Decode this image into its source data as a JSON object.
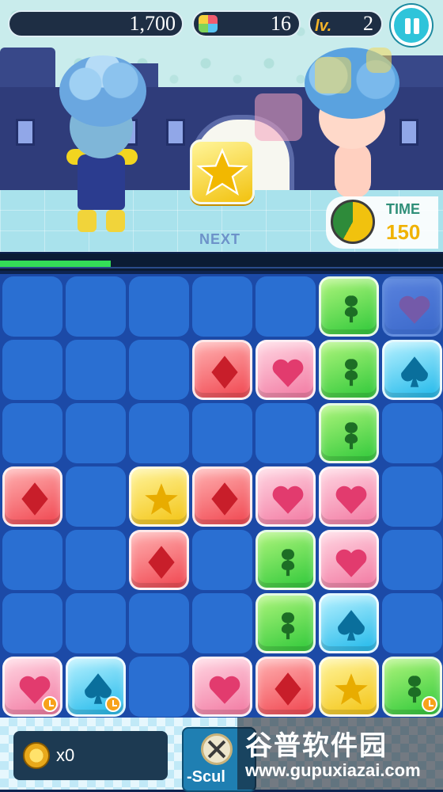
{
  "hud": {
    "score": "1,700",
    "piece_count": "16",
    "level_label": "lv.",
    "level": "2"
  },
  "next": {
    "label": "NEXT",
    "shape": "star"
  },
  "timer": {
    "label": "TIME",
    "value": "150",
    "remaining_fraction": 0.58
  },
  "progress": {
    "fraction": 0.25
  },
  "board": {
    "rows": 7,
    "cols": 7,
    "cells": [
      [
        "",
        "",
        "",
        "",
        "",
        "club",
        "ghost-heart"
      ],
      [
        "",
        "",
        "",
        "diamond",
        "heart",
        "club",
        "spade"
      ],
      [
        "",
        "",
        "",
        "",
        "",
        "club",
        ""
      ],
      [
        "diamond",
        "",
        "star",
        "diamond",
        "heart",
        "heart",
        ""
      ],
      [
        "",
        "",
        "diamond",
        "",
        "club",
        "heart",
        ""
      ],
      [
        "",
        "",
        "",
        "",
        "club",
        "spade",
        ""
      ],
      [
        "heart*",
        "spade*",
        "",
        "heart",
        "diamond",
        "star",
        "club*"
      ]
    ],
    "colors": {
      "club": "#2fc83a",
      "diamond": "#f0454f",
      "heart": "#f278a1",
      "spade": "#20b8ea",
      "star": "#f3c414"
    }
  },
  "bottom": {
    "coins": "x0",
    "skill_label": "-Scul"
  },
  "watermark": {
    "chinese": "谷普软件园",
    "url": "www.gupuxiazai.com"
  }
}
